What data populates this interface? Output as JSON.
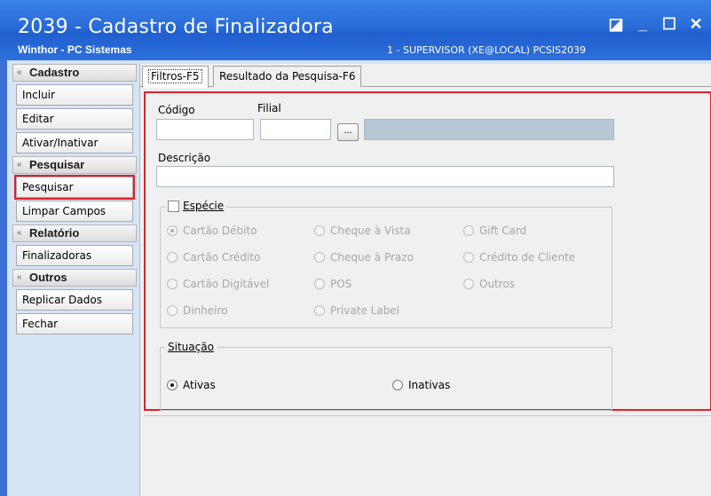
{
  "window": {
    "title": "2039 - Cadastro de Finalizadora",
    "company": "Winthor - PC Sistemas",
    "user_info": "1 - SUPERVISOR (XE@LOCAL)   PCSIS2039",
    "controls": [
      "restore-icon",
      "minimize-icon",
      "maximize-icon",
      "close-icon"
    ]
  },
  "sidebar": {
    "cadastro": {
      "title": "Cadastro",
      "items": [
        "Incluir",
        "Editar",
        "Ativar/Inativar"
      ]
    },
    "pesquisar": {
      "title": "Pesquisar",
      "items": [
        "Pesquisar",
        "Limpar Campos"
      ]
    },
    "relatorio": {
      "title": "Relatório",
      "items": [
        "Finalizadoras"
      ]
    },
    "outros": {
      "title": "Outros",
      "items": [
        "Replicar Dados",
        "Fechar"
      ]
    }
  },
  "tabs": {
    "filtros": "Filtros-F5",
    "resultado": "Resultado da Pesquisa-F6"
  },
  "filters": {
    "codigo_label": "Código",
    "filial_label": "Filial",
    "ellipsis": "...",
    "descricao_label": "Descrição",
    "codigo_value": "",
    "filial_value": "",
    "descricao_value": ""
  },
  "especie": {
    "legend": "Espécie",
    "options": {
      "cartao_debito": "Cartão Débito",
      "cheque_vista": "Cheque à Vista",
      "gift_card": "Gift Card",
      "cartao_credito": "Cartão Crédito",
      "cheque_prazo": "Cheque à Prazo",
      "credito_cliente": "Crédito de Cliente",
      "cartao_digitavel": "Cartão Digitável",
      "pos": "POS",
      "outros": "Outros",
      "dinheiro": "Dinheiro",
      "private_label": "Private Label"
    },
    "selected": "Cartão Débito"
  },
  "situacao": {
    "legend": "Situação",
    "ativas": "Ativas",
    "inativas": "Inativas",
    "selected": "Ativas"
  },
  "colors": {
    "highlight": "#e0202a",
    "titlebar": "#2a6bd8"
  }
}
